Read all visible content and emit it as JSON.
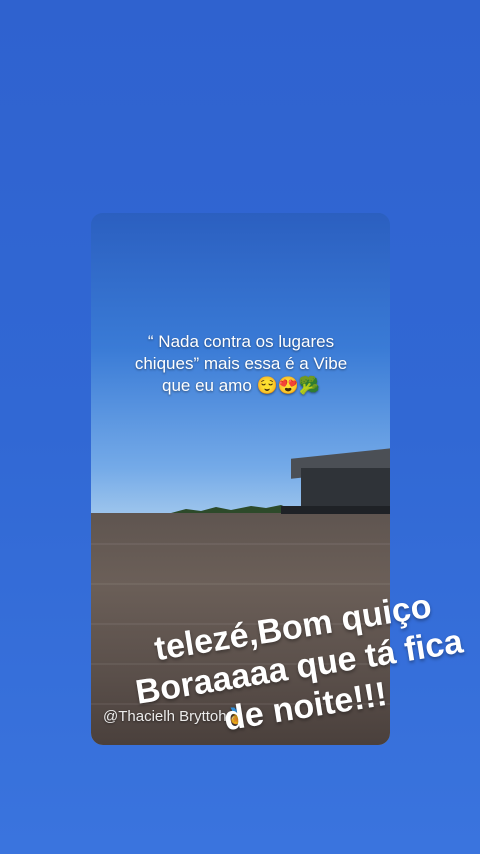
{
  "video": {
    "overlay_text_line1": "“ Nada contra os lugares",
    "overlay_text_line2": "chiques” mais essa é a Vibe",
    "overlay_text_line3": "que eu amo 😌😍🥦",
    "watermark": "@Thacielh Bryttoh🏅"
  },
  "caption": {
    "line1": "telezé,Bom quiço",
    "line2": "Boraaaaa que tá fica",
    "line3": "de noite!!!"
  },
  "colors": {
    "background": "#3168d4",
    "caption_text": "#ffffff"
  }
}
